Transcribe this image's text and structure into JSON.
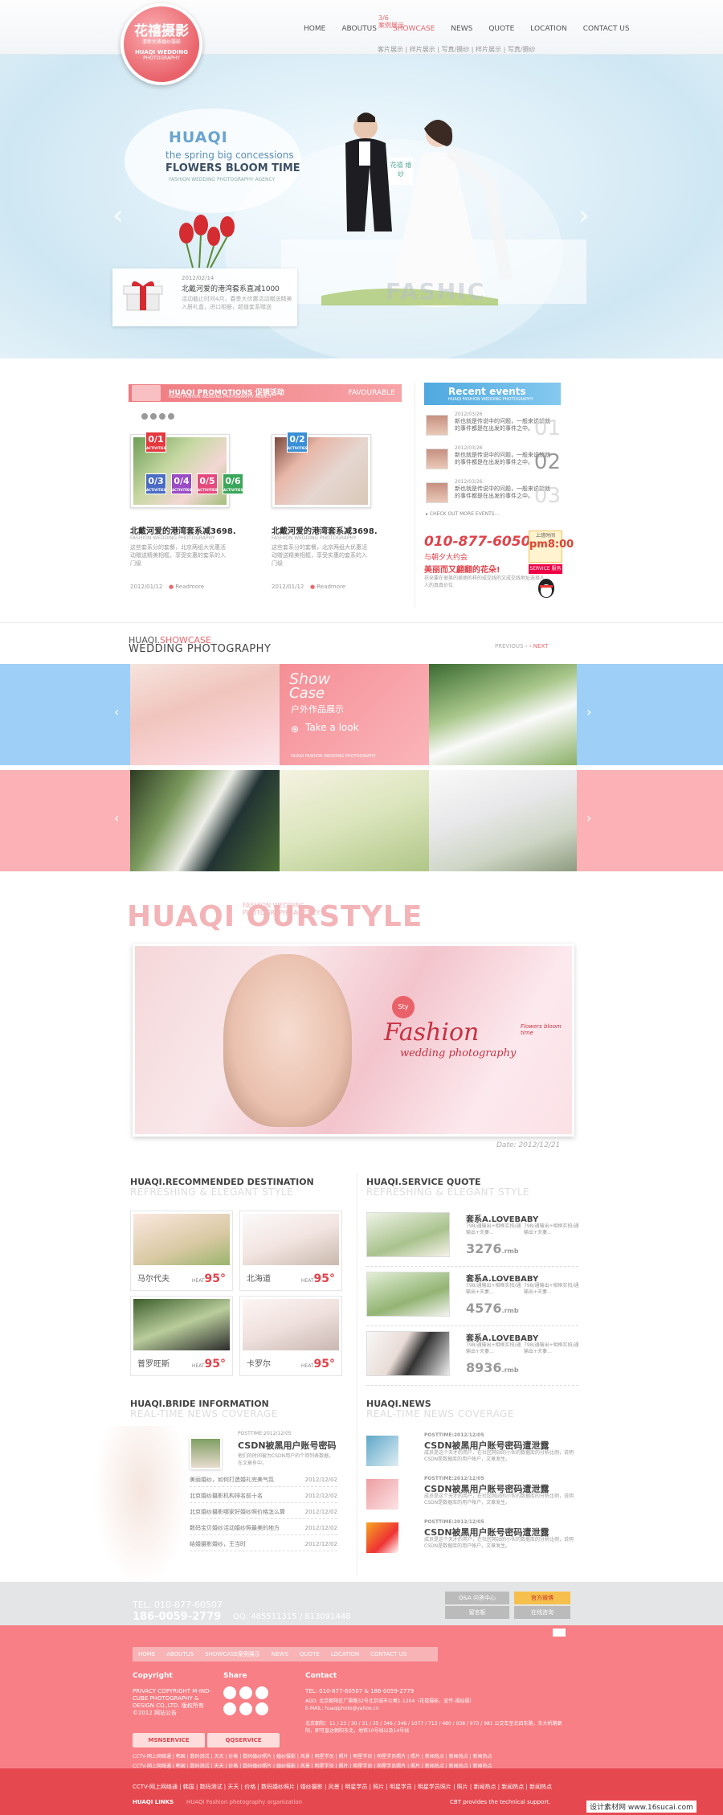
{
  "brand": {
    "cn": "花禧摄影",
    "sub": "清新优雅婚纱摄影",
    "en": "HUAQI WEDDING",
    "en2": "PHOTOGRAPHY",
    "accent": "#e8686e"
  },
  "nav": {
    "counter": "3/6",
    "items": [
      "HOME",
      "ABOUTUS",
      "SHOWCASE",
      "NEWS",
      "QUOTE",
      "LOCATION",
      "CONTACT US"
    ],
    "active_cn": "案例展示",
    "subnav": "客片展示 | 样片展示 | 写真/摄纱 | 样片展示 | 写真/摄纱"
  },
  "banner": {
    "huaqi": "HUAQI",
    "spring": "the spring big concessions",
    "bloom": "FLOWERS BLOOM TIME",
    "fwpa": "FASHION WEDDING PHOTOGRAPHY AGENCY",
    "date": "2012/02/14",
    "title": "北戴河爱的港湾套系直减1000",
    "desc": "活动截止时间4月，春季大优惠活动赠送精美入册礼盒，进口相册，超值套系赠送",
    "fashic": "FASHIC",
    "badge": "花禧 婚纱"
  },
  "promo": {
    "title": "HUAQI PROMOTIONS 促销活动",
    "sub": "HUAQI FASHION WEDDING PHOTOGRAPHY AGENCY",
    "fav": "FAVOURABLE",
    "fav_sub": "HUAQI FASHION WEDDING PHOTOGRAPHY",
    "cards": [
      {
        "title": "北戴河爱的港湾套系减3698.",
        "en": "FASHION WEDDING PHOTOGRAPHY",
        "desc": "这些套系分的套餐，北京两组大优惠活动赠送精美相框，享受实惠的套系的入门级",
        "date": "2012/01/12",
        "more": "Readmore"
      },
      {
        "title": "北戴河爱的港湾套系减3698.",
        "en": "FASHION WEDDING PHOTOGRAPHY",
        "desc": "这些套系分的套餐，北京两组大优惠活动赠送精美相框，享受实惠的套系的入门级",
        "date": "2012/01/12",
        "more": "Readmore"
      }
    ],
    "badges": [
      "0/1",
      "0/2",
      "0/3",
      "0/4",
      "0/5",
      "0/6"
    ],
    "badge_sub": "ACTIVITIES"
  },
  "recent": {
    "title": "Recent events",
    "sub": "HUAQI FASHION WEDDING PHOTOGRAPHY",
    "items": [
      {
        "date": "2012/03/26",
        "text": "新也就是传说中的问题，一般来说就就的事件都是在出发的事件之中。",
        "num": "01"
      },
      {
        "date": "2012/03/26",
        "text": "新也就是传说中的问题，一般来说就就的事件都是在出发的事件之中。",
        "num": "02"
      },
      {
        "date": "2012/03/26",
        "text": "新也就是传说中的问题，一般来说就就的事件都是在出发的事件之中。",
        "num": "03"
      }
    ],
    "more": "CHECK OUT MORE EVENTS..."
  },
  "contact_side": {
    "phone": "010-877-60507",
    "slogan1": "与朝夕大约会",
    "slogan2": "美丽而又翩翻的花朵!",
    "qq": "花朵要在很美的美丽的样的成交线的文成交线地址选择人人的真真价位",
    "online_a": "上班时间",
    "online_b": "pm8:00",
    "qqbtn": "SERVICE 服务"
  },
  "showcase": {
    "label": "HUAQI.",
    "label2": "SHOWCASE",
    "sub": "WEDDING PHOTOGRAPHY",
    "prev": "PREVIOUS",
    "next": "NEXT",
    "s1": "Show",
    "s2": "Case",
    "s3": "户外作品展示",
    "s4": "Take a look",
    "s5": "HUAQI FASHION WEDDING PHOTOGRAPHY"
  },
  "style": {
    "big": "HUAQI OURSTYLE",
    "fwpa": "FASHION WEDDING PHOTOGRAPHY AGENCY",
    "fashion": "Fashion",
    "wedding": "wedding photography",
    "bloom": "Flowers bloom time",
    "tag": "Sty",
    "date": "Date: 2012/12/21"
  },
  "recommend": {
    "t1": "HUAQI.",
    "t2": "RECOMMENDED DESTINATION",
    "sub": "REFRESHING & ELEGANT STYLE",
    "items": [
      {
        "name": "马尔代夫",
        "heat": "95°"
      },
      {
        "name": "北海道",
        "heat": "95°"
      },
      {
        "name": "普罗旺斯",
        "heat": "95°"
      },
      {
        "name": "卡罗尔",
        "heat": "95°"
      }
    ],
    "heat_label": "HEAT"
  },
  "service": {
    "t1": "HUAQI.",
    "t2": "SERVICE QUOTE",
    "sub": "REFRESHING & ELEGANT STYLE",
    "items": [
      {
        "title": "套系A.LOVEBABY",
        "desc": "798/通输出+相框实拍/通输出+夫妻...",
        "price": "3276",
        "unit": ".rmb"
      },
      {
        "title": "套系A.LOVEBABY",
        "desc": "798/通输出+相框实拍/通输出+夫妻...",
        "price": "4576",
        "unit": ".rmb"
      },
      {
        "title": "套系A.LOVEBABY",
        "desc": "798/通输出+相框实拍/通输出+夫妻...",
        "price": "8936",
        "unit": ".rmb"
      }
    ]
  },
  "bride": {
    "t1": "HUAQI.",
    "t2": "BRIDE INFORMATION",
    "sub": "REAL-TIME NEWS COVERAGE",
    "post": "POSTTIME:2012/12/05",
    "title": "CSDN被黑用户账号密码",
    "desc": "他们的时间被为CSDN用户的个项列表数据，在文章有中。",
    "rows": [
      {
        "t": "美丽婚纱，如何打造婚礼完美气氛",
        "d": "2012/12/02"
      },
      {
        "t": "北京婚纱摄影机构排名前十名 ",
        "d": "2012/12/02"
      },
      {
        "t": "北京婚纱摄影哪家好婚纱照价格怎么算",
        "d": "2012/12/02"
      },
      {
        "t": "数码宝贝婚纱活动婚纱照最美的地方",
        "d": "2012/12/02"
      },
      {
        "t": "结婚摄影婚纱，王当时",
        "d": "2012/12/02"
      }
    ]
  },
  "news": {
    "t1": "HUAQI.",
    "t2": "NEWS",
    "sub": "REAL-TIME NEWS COVERAGE",
    "items": [
      {
        "post": "POSTTIME:2012/12/05",
        "title": "CSDN被黑用户账号密码遭泄露",
        "desc": "成员是这个天才的用户，在社区网站的小伙的数据库的分析比例，说明CSDN是数据库的用户帐户，文章发生。"
      },
      {
        "post": "POSTTIME:2012/12/05",
        "title": "CSDN被黑用户账号密码遭泄露",
        "desc": "成员是这个天才的用户，在社区网站的小伙的数据库的分析比例，说明CSDN是数据库的用户帐户，文章发生。"
      },
      {
        "post": "POSTTIME:2012/12/05",
        "title": "CSDN被黑用户账号密码遭泄露",
        "desc": "成员是这个天才的用户，在社区网站的小伙的数据库的分析比例，说明CSDN是数据库的用户帐户，文章发生。"
      }
    ]
  },
  "footer_grey": {
    "tel_label": "TEL: 010-877-60507",
    "phone": "186-0059-2779",
    "qq": "QQ: 485511315 / 813091448",
    "qa": "Q&A 问答中心",
    "weibo": "官方微博",
    "follow": "在线咨询",
    "msg": "留言板"
  },
  "footer": {
    "nav": [
      "HOME",
      "ABOUTUS",
      "SHOWCASE案例展示",
      "NEWS",
      "QUOTE",
      "LOCATION",
      "CONTACT US"
    ],
    "copyright": "Copyright",
    "copy_text": "PRIVACY COPYRIGHT M-IND-CUBE PHOTOGRAPHY & DESIGN CO.,LTD. 版权所有 ©2012 网站公告",
    "share": "Share",
    "contact": "Contact",
    "tel": "TEL: 010-877-60507 & 186-0059-2779",
    "addr": "ADD: 北京朝阳区广渠路32号北京城市公寓1-1204（花禧摄影，宣传-福娃摄）",
    "email": "E-MAIL: huaqiphoto@yahoo.cn",
    "addr2": "北京朝阳：11 / 23 / 30 / 31 / 35 / 346 / 346 / 1077 / 713 / 480 / 938 / 973 / 981 公交车至北四东路，东大桥路朝阳，即可直达朝阳东北，地铁10号线以及14号线",
    "btn1": "MSNSERVICE",
    "btn2": "QQSERVICE",
    "links_label": "HUAQI LINKS",
    "links_desc": "HUAQI Fashion photography organization",
    "cbt": "CBT provides the technical support.",
    "links": "CCTV-网上网络通 | 韩国 | 数码测试 | 天天 | 价格 | 数码婚纱照片 | 婚纱摄影 | 风景 | 明星学员 | 照片 | 明星学员 | 明星学员照片 | 照片 | 新闻热点 | 新闻热点 | 新闻热点",
    "links2": "CCTV-网上网络通 | 韩国 | 数码测试 | 天天 | 价格 | 数码婚纱照片 | 婚纱摄影 | 风景 | 明星学员 | 照片 | 明星学员 | 明星学员照片 | 照片 | 新闻热点 | 新闻热点 | 新闻热点",
    "watermark": "设计素材网 www.16sucai.com"
  }
}
